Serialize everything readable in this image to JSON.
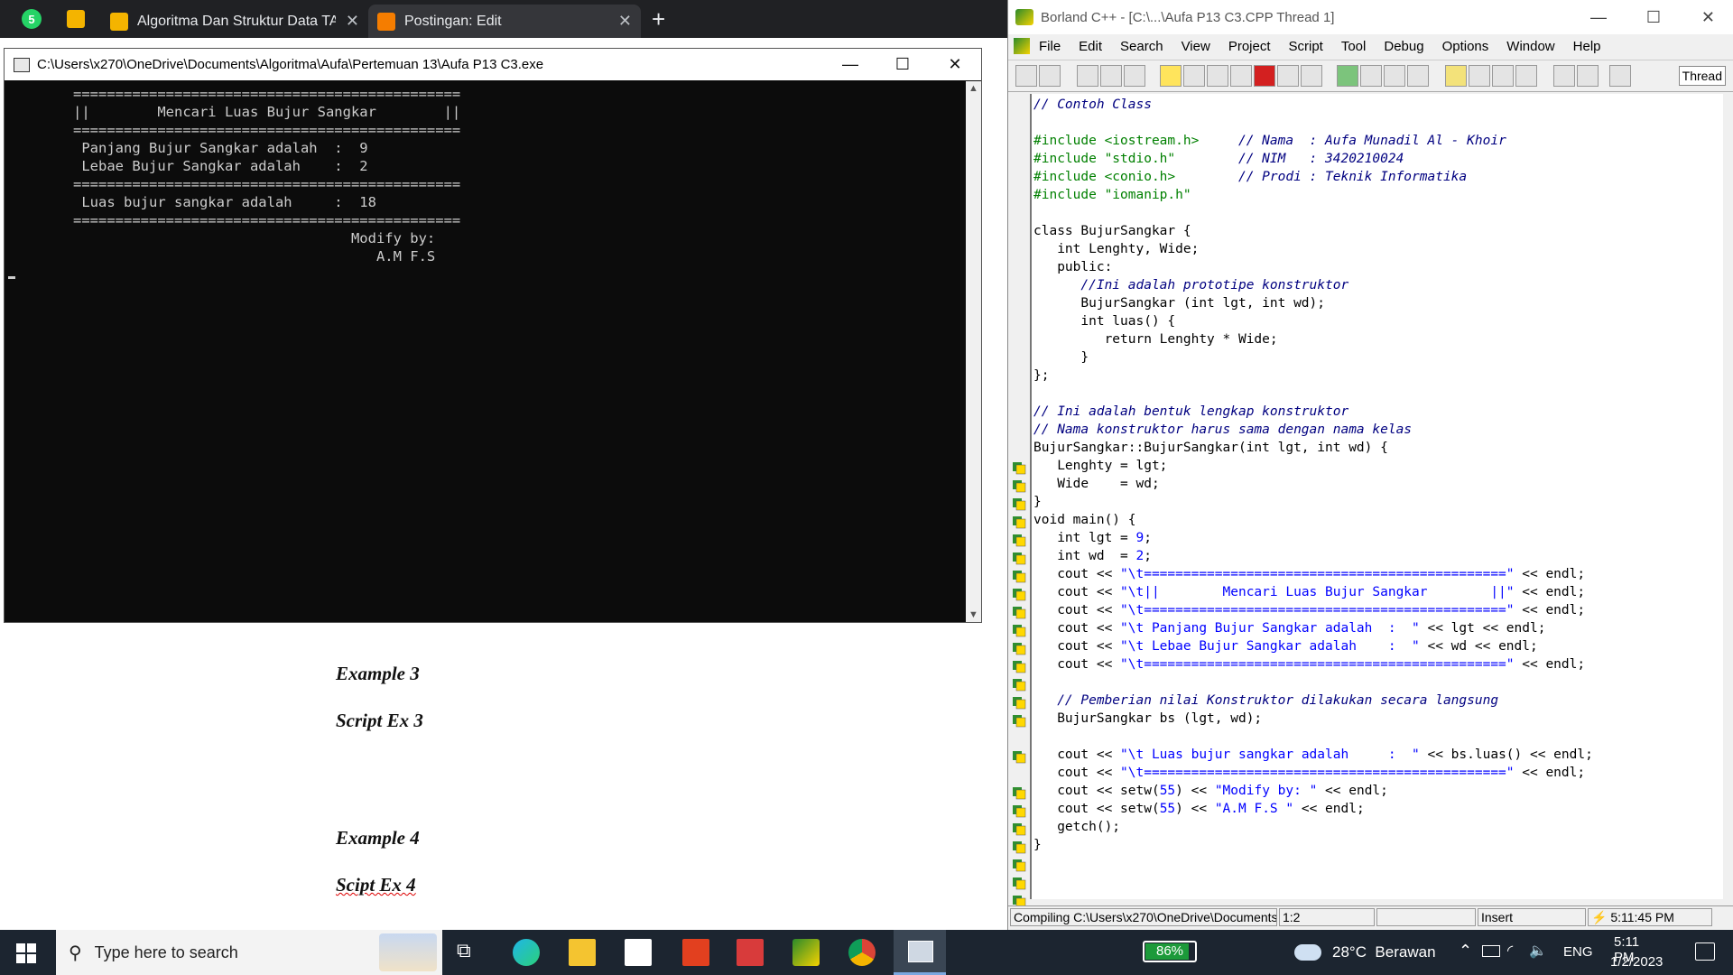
{
  "browser": {
    "tabs": [
      {
        "label": "Algoritma Dan Struktur Data TA 2",
        "icon": "slides-icon"
      },
      {
        "label": "Postingan: Edit",
        "icon": "blogger-icon",
        "active": true
      }
    ],
    "whatsapp_badge": "5",
    "new_tab": "+",
    "page": {
      "lines": [
        "Example 3",
        "Script Ex 3",
        "Example 4",
        "Scipt Ex 4"
      ]
    }
  },
  "console": {
    "title": "C:\\Users\\x270\\OneDrive\\Documents\\Algoritma\\Aufa\\Pertemuan 13\\Aufa P13 C3.exe",
    "output": "==============================================\n||        Mencari Luas Bujur Sangkar        ||\n==============================================\n Panjang Bujur Sangkar adalah  :  9\n Lebae Bujur Sangkar adalah    :  2\n==============================================\n Luas bujur sangkar adalah     :  18\n==============================================\n                                 Modify by:\n                                    A.M F.S"
  },
  "ide": {
    "title": "Borland C++ - [C:\\...\\Aufa P13 C3.CPP Thread 1]",
    "menu": [
      "File",
      "Edit",
      "Search",
      "View",
      "Project",
      "Script",
      "Tool",
      "Debug",
      "Options",
      "Window",
      "Help"
    ],
    "toolbar_label": "Thread",
    "status": {
      "compiling": "Compiling C:\\Users\\x270\\OneDrive\\Documents",
      "position": "1:2",
      "mode": "Insert",
      "time": "5:11:45 PM"
    }
  },
  "taskbar": {
    "search_placeholder": "Type here to search",
    "battery": "86%",
    "weather": "28°C  Berawan",
    "language": "ENG",
    "clock_time": "5:11 PM",
    "clock_date": "1/2/2023"
  }
}
